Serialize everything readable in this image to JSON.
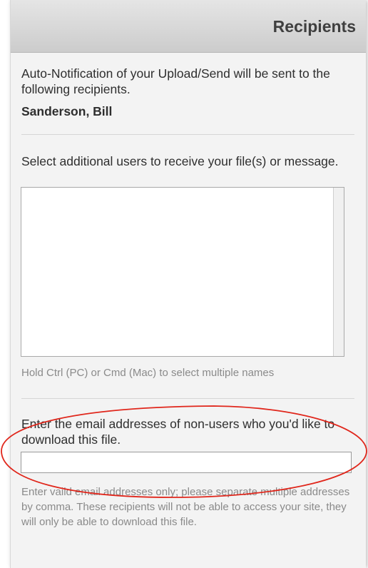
{
  "panel": {
    "title": "Recipients"
  },
  "auto_notification": {
    "text": "Auto-Notification of your Upload/Send will be sent to the following recipients.",
    "recipient": "Sanderson, Bill"
  },
  "additional_users": {
    "label": "Select additional users to receive your file(s) or message.",
    "options": [],
    "hint": "Hold Ctrl (PC) or Cmd (Mac) to select multiple names"
  },
  "non_users": {
    "label": "Enter the email addresses of non-users who you'd like to download this file.",
    "value": "",
    "hint": "Enter vaild email addresses only; please separate multiple addresses by comma. These recipients will not be able to access your site, they will only be able to download this file."
  },
  "colors": {
    "annotation": "#e0261b",
    "panel_background": "#f3f3f3",
    "header_gradient_top": "#e5e5e5",
    "header_gradient_bottom": "#cccccc"
  }
}
